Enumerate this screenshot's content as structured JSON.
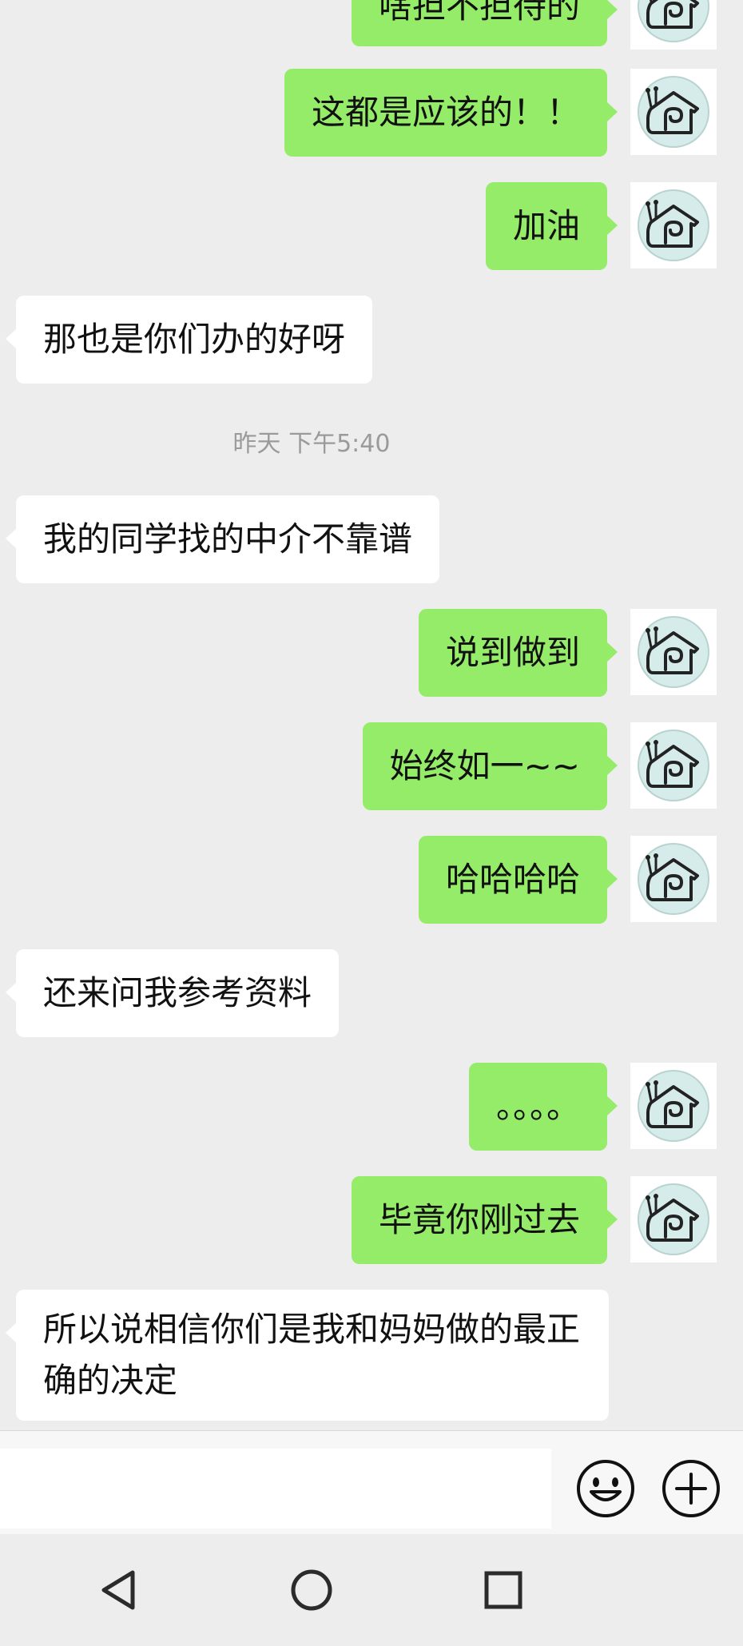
{
  "timestamp": "昨天 下午5:40",
  "messages": [
    {
      "side": "me",
      "text": "啥担不担待的"
    },
    {
      "side": "me",
      "text": "这都是应该的！！"
    },
    {
      "side": "me",
      "text": "加油"
    },
    {
      "side": "them",
      "text": "那也是你们办的好呀"
    },
    {
      "side": "them",
      "text": "我的同学找的中介不靠谱"
    },
    {
      "side": "me",
      "text": "说到做到"
    },
    {
      "side": "me",
      "text": "始终如一~~"
    },
    {
      "side": "me",
      "text": "哈哈哈哈"
    },
    {
      "side": "them",
      "text": "还来问我参考资料"
    },
    {
      "side": "me",
      "text": "。。。。"
    },
    {
      "side": "me",
      "text": "毕竟你刚过去"
    },
    {
      "side": "them",
      "text": "所以说相信你们是我和妈妈做的最正确的决定"
    }
  ],
  "input": {
    "value": "",
    "placeholder": ""
  },
  "icons": {
    "avatar": "snail-house-avatar",
    "emoji": "smiley-icon",
    "more": "plus-circle-icon",
    "nav_back": "triangle-back-icon",
    "nav_home": "circle-home-icon",
    "nav_recents": "square-recents-icon"
  },
  "colors": {
    "sent_bubble": "#95ec69",
    "received_bubble": "#ffffff",
    "background": "#ededed",
    "timestamp_text": "#9a9a9a"
  }
}
